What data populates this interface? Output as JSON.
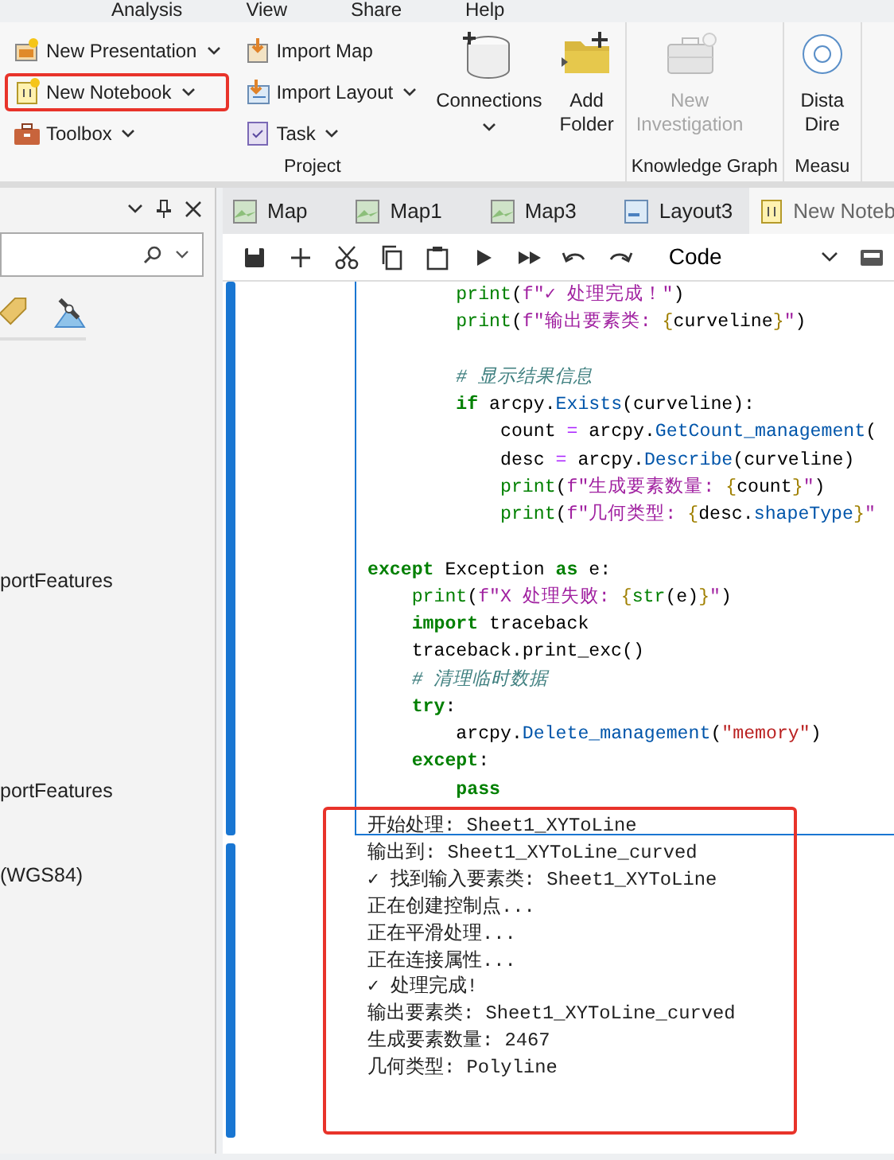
{
  "menu": [
    "Analysis",
    "View",
    "Share",
    "Help"
  ],
  "ribbon": {
    "groups": [
      {
        "label": "Project",
        "small_columns": [
          [
            {
              "label": "New Presentation",
              "dropdown": true,
              "highlighted": false
            },
            {
              "label": "New Notebook",
              "dropdown": true,
              "highlighted": true
            },
            {
              "label": "Toolbox",
              "dropdown": true,
              "highlighted": false
            }
          ],
          [
            {
              "label": "Import Map",
              "dropdown": false,
              "highlighted": false
            },
            {
              "label": "Import Layout",
              "dropdown": true,
              "highlighted": false
            },
            {
              "label": "Task",
              "dropdown": true,
              "highlighted": false
            }
          ]
        ],
        "large": [
          {
            "lines": [
              "Connections"
            ],
            "dropdown": true,
            "disabled": false
          },
          {
            "lines": [
              "Add",
              "Folder"
            ],
            "dropdown": false,
            "disabled": false
          }
        ]
      },
      {
        "label": "Knowledge Graph",
        "large": [
          {
            "lines": [
              "New",
              "Investigation"
            ],
            "dropdown": false,
            "disabled": true
          }
        ]
      },
      {
        "label": "Measu",
        "large": [
          {
            "lines": [
              "Dista",
              "Dire"
            ],
            "dropdown": false,
            "disabled": false
          }
        ]
      }
    ]
  },
  "left_panel": {
    "items": [
      "portFeatures",
      "portFeatures",
      "(WGS84)"
    ]
  },
  "tabs": [
    {
      "label": "Map",
      "selected": false
    },
    {
      "label": "Map1",
      "selected": false
    },
    {
      "label": "Map3",
      "selected": false
    },
    {
      "label": "Layout3",
      "selected": false
    },
    {
      "label": "New Noteb",
      "selected": true
    }
  ],
  "toolbar": {
    "cell_type": "Code"
  },
  "code_lines": [
    {
      "tokens": [
        {
          "kind": "builtin",
          "text": "        print"
        },
        {
          "kind": "plain",
          "text": "("
        },
        {
          "kind": "fstr",
          "text": "f\"✓ 处理完成！\""
        },
        {
          "kind": "plain",
          "text": ")"
        }
      ]
    },
    {
      "tokens": [
        {
          "kind": "builtin",
          "text": "        print"
        },
        {
          "kind": "plain",
          "text": "("
        },
        {
          "kind": "fstr",
          "text": "f\"输出要素类: "
        },
        {
          "kind": "brace",
          "text": "{"
        },
        {
          "kind": "plain",
          "text": "curveline"
        },
        {
          "kind": "brace",
          "text": "}"
        },
        {
          "kind": "fstr",
          "text": "\""
        },
        {
          "kind": "plain",
          "text": ")"
        }
      ]
    },
    {
      "space_before": true,
      "tokens": [
        {
          "kind": "cmt",
          "text": "        # 显示结果信息"
        }
      ]
    },
    {
      "tokens": [
        {
          "kind": "kw",
          "text": "        if"
        },
        {
          "kind": "plain",
          "text": " arcpy."
        },
        {
          "kind": "attr",
          "text": "Exists"
        },
        {
          "kind": "plain",
          "text": "(curveline):"
        }
      ]
    },
    {
      "tokens": [
        {
          "kind": "plain",
          "text": "            count "
        },
        {
          "kind": "op",
          "text": "="
        },
        {
          "kind": "plain",
          "text": " arcpy."
        },
        {
          "kind": "attr",
          "text": "GetCount_management"
        },
        {
          "kind": "plain",
          "text": "("
        }
      ]
    },
    {
      "tokens": [
        {
          "kind": "plain",
          "text": "            desc "
        },
        {
          "kind": "op",
          "text": "="
        },
        {
          "kind": "plain",
          "text": " arcpy."
        },
        {
          "kind": "attr",
          "text": "Describe"
        },
        {
          "kind": "plain",
          "text": "(curveline)"
        }
      ]
    },
    {
      "tokens": [
        {
          "kind": "builtin",
          "text": "            print"
        },
        {
          "kind": "plain",
          "text": "("
        },
        {
          "kind": "fstr",
          "text": "f\"生成要素数量: "
        },
        {
          "kind": "brace",
          "text": "{"
        },
        {
          "kind": "plain",
          "text": "count"
        },
        {
          "kind": "brace",
          "text": "}"
        },
        {
          "kind": "fstr",
          "text": "\""
        },
        {
          "kind": "plain",
          "text": ")"
        }
      ]
    },
    {
      "tokens": [
        {
          "kind": "builtin",
          "text": "            print"
        },
        {
          "kind": "plain",
          "text": "("
        },
        {
          "kind": "fstr",
          "text": "f\"几何类型: "
        },
        {
          "kind": "brace",
          "text": "{"
        },
        {
          "kind": "plain",
          "text": "desc."
        },
        {
          "kind": "attr",
          "text": "shapeType"
        },
        {
          "kind": "brace",
          "text": "}"
        },
        {
          "kind": "fstr",
          "text": "\""
        }
      ]
    },
    {
      "space_before": true,
      "tokens": [
        {
          "kind": "kw",
          "text": "except"
        },
        {
          "kind": "plain",
          "text": " Exception "
        },
        {
          "kind": "kw",
          "text": "as"
        },
        {
          "kind": "plain",
          "text": " e:"
        }
      ]
    },
    {
      "tokens": [
        {
          "kind": "builtin",
          "text": "    print"
        },
        {
          "kind": "plain",
          "text": "("
        },
        {
          "kind": "fstr",
          "text": "f\"X 处理失败: "
        },
        {
          "kind": "brace",
          "text": "{"
        },
        {
          "kind": "builtin",
          "text": "str"
        },
        {
          "kind": "plain",
          "text": "(e)"
        },
        {
          "kind": "brace",
          "text": "}"
        },
        {
          "kind": "fstr",
          "text": "\""
        },
        {
          "kind": "plain",
          "text": ")"
        }
      ]
    },
    {
      "tokens": [
        {
          "kind": "kw",
          "text": "    import"
        },
        {
          "kind": "plain",
          "text": " traceback"
        }
      ]
    },
    {
      "tokens": [
        {
          "kind": "plain",
          "text": "    traceback.print_exc()"
        }
      ]
    },
    {
      "tokens": [
        {
          "kind": "cmt",
          "text": "    # 清理临时数据"
        }
      ]
    },
    {
      "tokens": [
        {
          "kind": "kw",
          "text": "    try"
        },
        {
          "kind": "plain",
          "text": ":"
        }
      ]
    },
    {
      "tokens": [
        {
          "kind": "plain",
          "text": "        arcpy."
        },
        {
          "kind": "attr",
          "text": "Delete_management"
        },
        {
          "kind": "plain",
          "text": "("
        },
        {
          "kind": "str",
          "text": "\"memory\""
        },
        {
          "kind": "plain",
          "text": ")"
        }
      ]
    },
    {
      "tokens": [
        {
          "kind": "kw",
          "text": "    except"
        },
        {
          "kind": "plain",
          "text": ":"
        }
      ]
    },
    {
      "tokens": [
        {
          "kind": "kw",
          "text": "        pass"
        }
      ]
    }
  ],
  "output": {
    "highlighted": true,
    "lines": [
      "开始处理: Sheet1_XYToLine",
      "输出到: Sheet1_XYToLine_curved",
      "✓ 找到输入要素类: Sheet1_XYToLine",
      "正在创建控制点...",
      "正在平滑处理...",
      "正在连接属性...",
      "✓ 处理完成!",
      "输出要素类: Sheet1_XYToLine_curved",
      "生成要素数量: 2467",
      "几何类型: Polyline"
    ]
  }
}
